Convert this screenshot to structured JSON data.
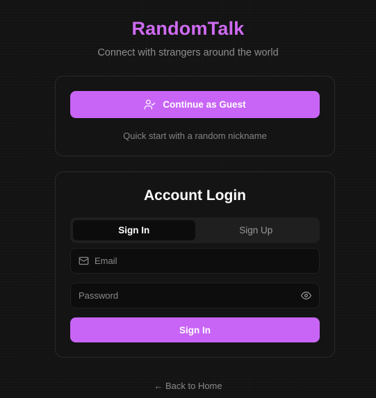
{
  "header": {
    "title": "RandomTalk",
    "subtitle": "Connect with strangers around the world"
  },
  "guest": {
    "button_label": "Continue as Guest",
    "button_icon": "user-check-icon",
    "hint": "Quick start with a random nickname"
  },
  "login": {
    "title": "Account Login",
    "tabs": [
      {
        "label": "Sign In",
        "active": true
      },
      {
        "label": "Sign Up",
        "active": false
      }
    ],
    "email": {
      "placeholder": "Email",
      "value": "",
      "icon": "mail-icon"
    },
    "password": {
      "placeholder": "Password",
      "value": "",
      "icon": "eye-icon"
    },
    "submit_label": "Sign In"
  },
  "footer": {
    "back_link": "← Back to Home"
  },
  "colors": {
    "accent": "#c865f6",
    "title": "#cf6bf2",
    "background": "#131313"
  }
}
